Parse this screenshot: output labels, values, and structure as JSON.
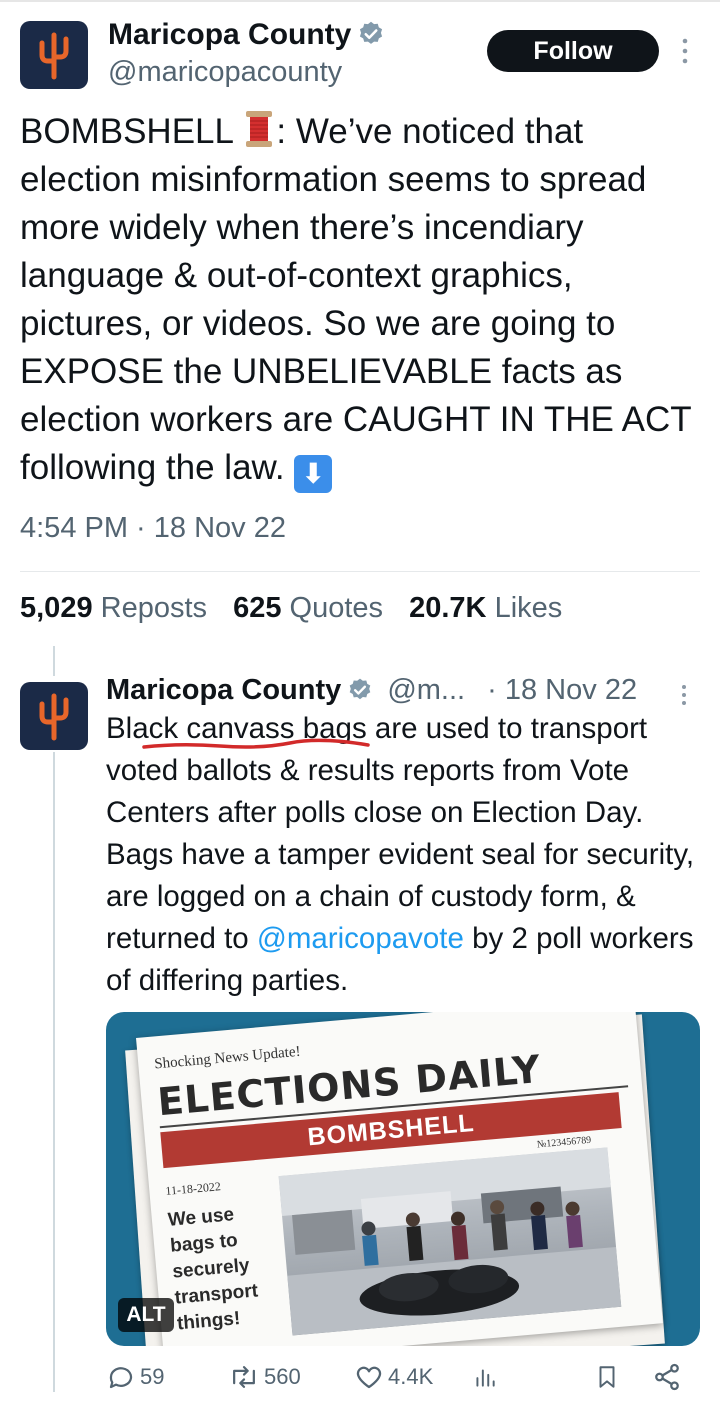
{
  "main_tweet": {
    "author_name": "Maricopa County",
    "author_handle": "@maricopacounty",
    "follow_label": "Follow",
    "more_label": "⋮",
    "text_part1": "BOMBSHELL ",
    "spool_emoji": "🧵",
    "text_part2": ": We’ve noticed that election misinformation seems to spread more widely when there’s incendiary language & out-of-context graphics, pictures, or videos. So we are going to EXPOSE the UNBELIEVABLE facts as election workers are CAUGHT IN THE ACT following the law. ",
    "down_arrow_emoji": "⬇",
    "timestamp": "4:54 PM · 18 Nov 22",
    "stats": {
      "reposts_count": "5,029",
      "reposts_label": "Reposts",
      "quotes_count": "625",
      "quotes_label": "Quotes",
      "likes_count": "20.7K",
      "likes_label": "Likes"
    }
  },
  "reply_tweet": {
    "author_name": "Maricopa County",
    "author_handle": "@m...",
    "date": "· 18 Nov 22",
    "more_label": "⋮",
    "text_part1": "Black canvass bags are used to transport voted ballots & results reports from Vote Centers after polls close on Election Day. Bags have a tamper evident seal for security, are logged on a chain of custody form, & returned to ",
    "mention": "@maricopavote",
    "text_part2": " by 2 poll workers of differing parties.",
    "media": {
      "alt_badge": "ALT",
      "kicker": "Shocking News Update!",
      "masthead": "ELECTIONS DAILY",
      "band": "BOMBSHELL",
      "issue_no": "№123456789",
      "date": "11-18-2022",
      "headline": "We use bags to securely transport things!"
    },
    "actions": {
      "replies": "59",
      "reposts": "560",
      "likes": "4.4K"
    }
  },
  "colors": {
    "text_primary": "#0f1419",
    "text_secondary": "#536471",
    "link": "#1d9bf0",
    "avatar_bg": "#1b2a47",
    "avatar_logo": "#e8662a",
    "verified": "#829aab",
    "media_bg": "#1e6e93",
    "band_red": "#b23a33"
  }
}
